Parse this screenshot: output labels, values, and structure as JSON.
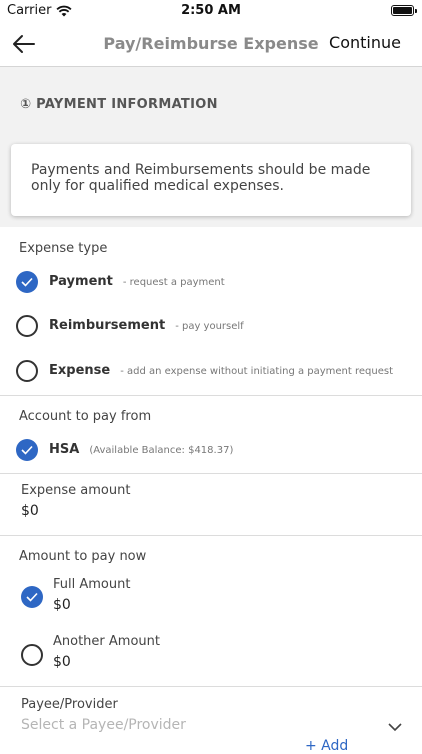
{
  "status": {
    "carrier": "Carrier",
    "time": "2:50 AM"
  },
  "nav": {
    "title": "Pay/Reimburse Expense",
    "action": "Continue"
  },
  "section": {
    "title": "① PAYMENT INFORMATION"
  },
  "notice": "Payments and Reimbursements should be made only for qualified medical expenses.",
  "expense_type": {
    "label": "Expense type",
    "options": [
      {
        "label": "Payment",
        "desc": "- request a payment",
        "selected": true
      },
      {
        "label": "Reimbursement",
        "desc": "- pay yourself",
        "selected": false
      },
      {
        "label": "Expense",
        "desc": "- add an expense without initiating a payment request",
        "selected": false
      }
    ]
  },
  "account": {
    "label": "Account to pay from",
    "name": "HSA",
    "balance": "(Available Balance: $418.37)"
  },
  "expense_amount": {
    "label": "Expense amount",
    "value": "$0"
  },
  "amount_now": {
    "label": "Amount to pay now",
    "options": [
      {
        "label": "Full Amount",
        "value": "$0",
        "selected": true
      },
      {
        "label": "Another Amount",
        "value": "$0",
        "selected": false
      }
    ]
  },
  "payee": {
    "label": "Payee/Provider",
    "placeholder": "Select a Payee/Provider",
    "add": "+ Add"
  },
  "colors": {
    "accent": "#2e67c4",
    "section_bg": "#f2f2f2"
  },
  "icons": [
    "wifi-icon",
    "battery-icon",
    "back-arrow-icon",
    "checkmark-icon",
    "chevron-down-icon"
  ]
}
